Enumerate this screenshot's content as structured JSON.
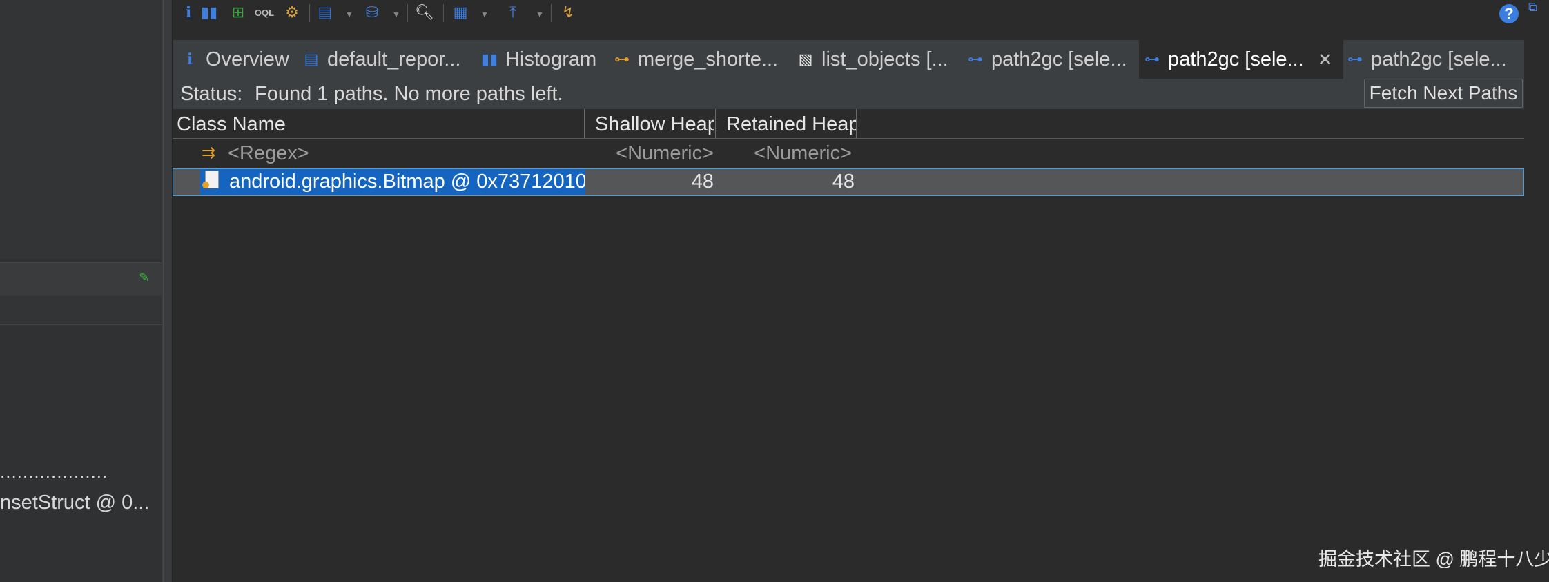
{
  "left_panel": {
    "dots": "...................",
    "row_text": "nsetStruct @ 0...",
    "pin_icon": "pin-icon"
  },
  "toolbar": {
    "icons": [
      "info-icon",
      "histogram-icon",
      "dominator-tree-icon",
      "oql-icon",
      "heap-dump-overview-icon",
      "query-browser-icon",
      "database-icon",
      "search-icon",
      "calculator-icon",
      "export-icon",
      "run-expert-icon"
    ],
    "help": "?"
  },
  "tabs": [
    {
      "label": "Overview",
      "icon": "info-icon"
    },
    {
      "label": "default_repor...",
      "icon": "report-icon"
    },
    {
      "label": "Histogram",
      "icon": "histogram-icon"
    },
    {
      "label": "merge_shorte...",
      "icon": "tree-icon"
    },
    {
      "label": "list_objects [...",
      "icon": "list-icon"
    },
    {
      "label": "path2gc [sele...",
      "icon": "path-icon"
    },
    {
      "label": "path2gc [sele...",
      "icon": "path-icon",
      "active": true,
      "close": "✕"
    },
    {
      "label": "path2gc [sele...",
      "icon": "path-icon"
    }
  ],
  "status": {
    "label": "Status:",
    "text": "Found 1 paths. No more paths left.",
    "button": "Fetch Next Paths"
  },
  "table": {
    "columns": [
      "Class Name",
      "Shallow Heap",
      "Retained Heap"
    ],
    "filter_row": [
      "<Regex>",
      "<Numeric>",
      "<Numeric>"
    ],
    "rows": [
      {
        "class_name": "android.graphics.Bitmap @ 0x73712010",
        "shallow": "48",
        "retained": "48"
      }
    ]
  },
  "watermark": "掘金技术社区 @ 鹏程十八少",
  "colors": {
    "accent": "#1565c0",
    "background": "#2b2b2b",
    "tab_bar": "#3c3f41"
  }
}
